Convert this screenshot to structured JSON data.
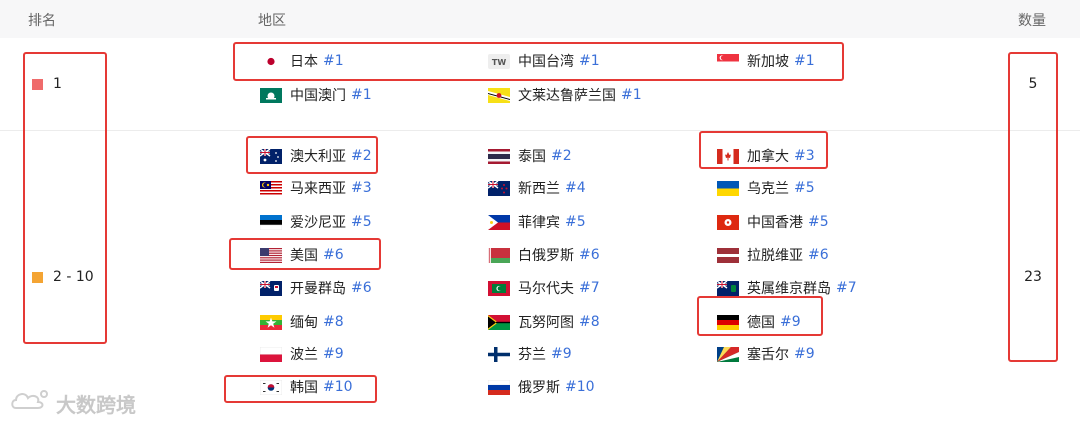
{
  "header": {
    "rank": "排名",
    "region": "地区",
    "count": "数量"
  },
  "groups": [
    {
      "rank": "1",
      "rank_color": "#ef6b6b",
      "count": "5",
      "entries": [
        {
          "name": "日本",
          "num": "#1",
          "flag": "japan-flag"
        },
        {
          "name": "中国台湾",
          "num": "#1",
          "flag": "tw-badge"
        },
        {
          "name": "新加坡",
          "num": "#1",
          "flag": "singapore-flag"
        },
        {
          "name": "中国澳门",
          "num": "#1",
          "flag": "macau-flag"
        },
        {
          "name": "文莱达鲁萨兰国",
          "num": "#1",
          "flag": "brunei-flag"
        }
      ]
    },
    {
      "rank": "2 - 10",
      "rank_color": "#f4a433",
      "count": "23",
      "entries": [
        {
          "name": "澳大利亚",
          "num": "#2",
          "flag": "australia-flag"
        },
        {
          "name": "泰国",
          "num": "#2",
          "flag": "thailand-flag"
        },
        {
          "name": "加拿大",
          "num": "#3",
          "flag": "canada-flag"
        },
        {
          "name": "马来西亚",
          "num": "#3",
          "flag": "malaysia-flag"
        },
        {
          "name": "新西兰",
          "num": "#4",
          "flag": "new-zealand-flag"
        },
        {
          "name": "乌克兰",
          "num": "#5",
          "flag": "ukraine-flag"
        },
        {
          "name": "爱沙尼亚",
          "num": "#5",
          "flag": "estonia-flag"
        },
        {
          "name": "菲律宾",
          "num": "#5",
          "flag": "philippines-flag"
        },
        {
          "name": "中国香港",
          "num": "#5",
          "flag": "hong-kong-flag"
        },
        {
          "name": "美国",
          "num": "#6",
          "flag": "usa-flag"
        },
        {
          "name": "白俄罗斯",
          "num": "#6",
          "flag": "belarus-flag"
        },
        {
          "name": "拉脱维亚",
          "num": "#6",
          "flag": "latvia-flag"
        },
        {
          "name": "开曼群岛",
          "num": "#6",
          "flag": "cayman-flag"
        },
        {
          "name": "马尔代夫",
          "num": "#7",
          "flag": "maldives-flag"
        },
        {
          "name": "英属维京群岛",
          "num": "#7",
          "flag": "bvi-flag"
        },
        {
          "name": "缅甸",
          "num": "#8",
          "flag": "myanmar-flag"
        },
        {
          "name": "瓦努阿图",
          "num": "#8",
          "flag": "vanuatu-flag"
        },
        {
          "name": "德国",
          "num": "#9",
          "flag": "germany-flag"
        },
        {
          "name": "波兰",
          "num": "#9",
          "flag": "poland-flag"
        },
        {
          "name": "芬兰",
          "num": "#9",
          "flag": "finland-flag"
        },
        {
          "name": "塞舌尔",
          "num": "#9",
          "flag": "seychelles-flag"
        },
        {
          "name": "韩国",
          "num": "#10",
          "flag": "korea-flag"
        },
        {
          "name": "俄罗斯",
          "num": "#10",
          "flag": "russia-flag"
        }
      ]
    }
  ],
  "badge_text": "TW",
  "watermark": {
    "text": "大数跨境",
    "icon": "cloud-logo-icon"
  },
  "colors": {
    "highlight": "#e53935",
    "link": "#3a6fd8"
  }
}
